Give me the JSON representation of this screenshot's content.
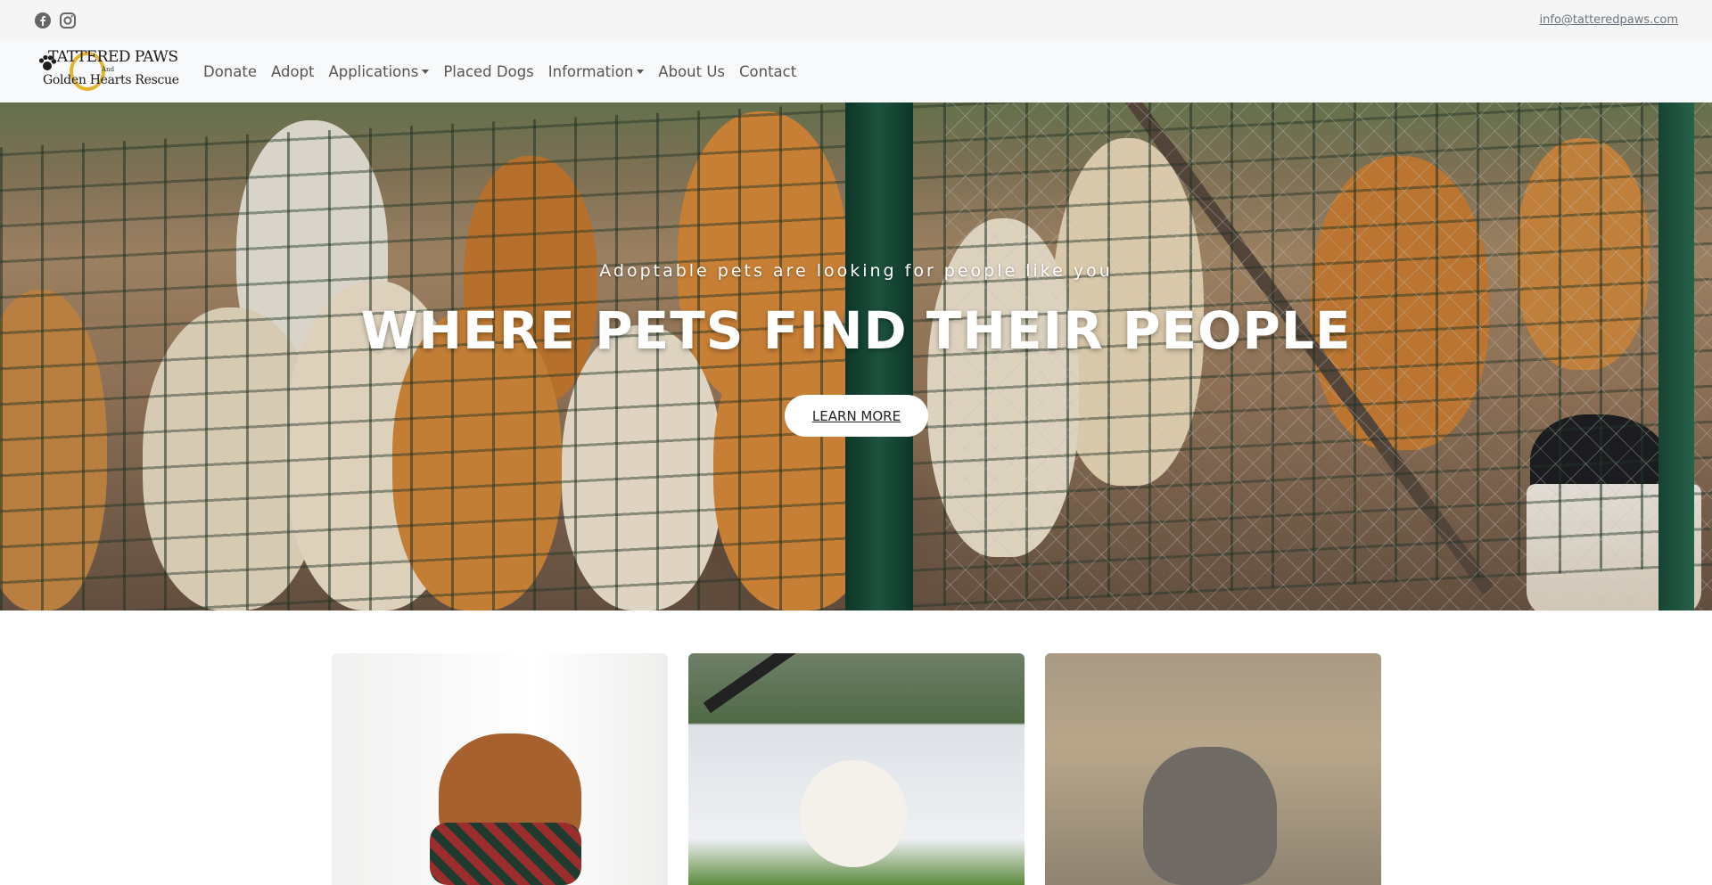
{
  "topbar": {
    "social": [
      {
        "icon": "facebook-icon"
      },
      {
        "icon": "instagram-icon"
      }
    ],
    "email": "info@tatteredpaws.com"
  },
  "logo": {
    "line1": "TATTERED PAWS",
    "and": "And",
    "line2": "Golden Hearts Rescue"
  },
  "nav": {
    "items": [
      {
        "label": "Donate",
        "dropdown": false
      },
      {
        "label": "Adopt",
        "dropdown": false
      },
      {
        "label": "Applications",
        "dropdown": true
      },
      {
        "label": "Placed Dogs",
        "dropdown": false
      },
      {
        "label": "Information",
        "dropdown": true
      },
      {
        "label": "About Us",
        "dropdown": false
      },
      {
        "label": "Contact",
        "dropdown": false
      }
    ]
  },
  "hero": {
    "subtitle": "Adoptable pets are looking for people like you",
    "title": "WHERE PETS FIND THEIR PEOPLE",
    "button": "LEARN MORE"
  },
  "colors": {
    "topbar_bg": "#f5f5f5",
    "navbar_bg": "#f8f9fa",
    "text_muted": "#6c757d",
    "button_bg": "#ffffff",
    "logo_gold": "#e1b530"
  }
}
